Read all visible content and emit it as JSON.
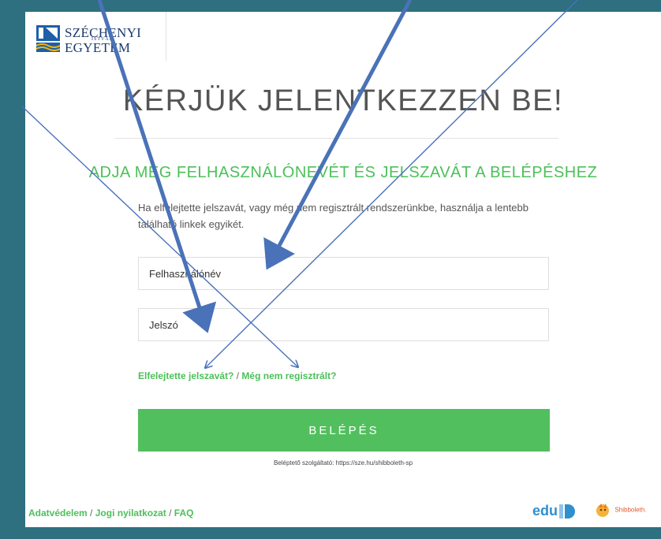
{
  "logo": {
    "line1": "SZÉCHENYI",
    "line2": "ISTVÁN",
    "line3": "EGYETEM"
  },
  "page_title": "KÉRJÜK JELENTKEZZEN BE!",
  "subtitle": "ADJA MEG FELHASZNÁLÓNEVÉT ÉS JELSZAVÁT A BELÉPÉSHEZ",
  "intro_text": "Ha elfelejtette jelszavát, vagy még nem regisztrált rendszerünkbe, használja a lentebb található linkek egyikét.",
  "form": {
    "username_placeholder": "Felhasználónév",
    "password_placeholder": "Jelszó",
    "forgot_link": "Elfelejtette jelszavát?",
    "links_separator": "/",
    "register_link": "Még nem regisztrált?",
    "login_button": "BELÉPÉS",
    "sp_info": "Beléptető szolgáltató: https://sze.hu/shibboleth-sp"
  },
  "footer": {
    "privacy": "Adatvédelem",
    "legal": "Jogi nyilatkozat",
    "faq": "FAQ",
    "separator": "/"
  },
  "brand_logos": {
    "eduid_text": "edu",
    "shibboleth_text": "Shibboleth."
  },
  "colors": {
    "background": "#2e6f80",
    "accent_green": "#52bf5e",
    "annotation_arrow": "#4a72b8",
    "logo_navy": "#1b3a6b"
  },
  "icons": [
    "university-logo-icon",
    "eduid-icon",
    "shibboleth-icon"
  ]
}
